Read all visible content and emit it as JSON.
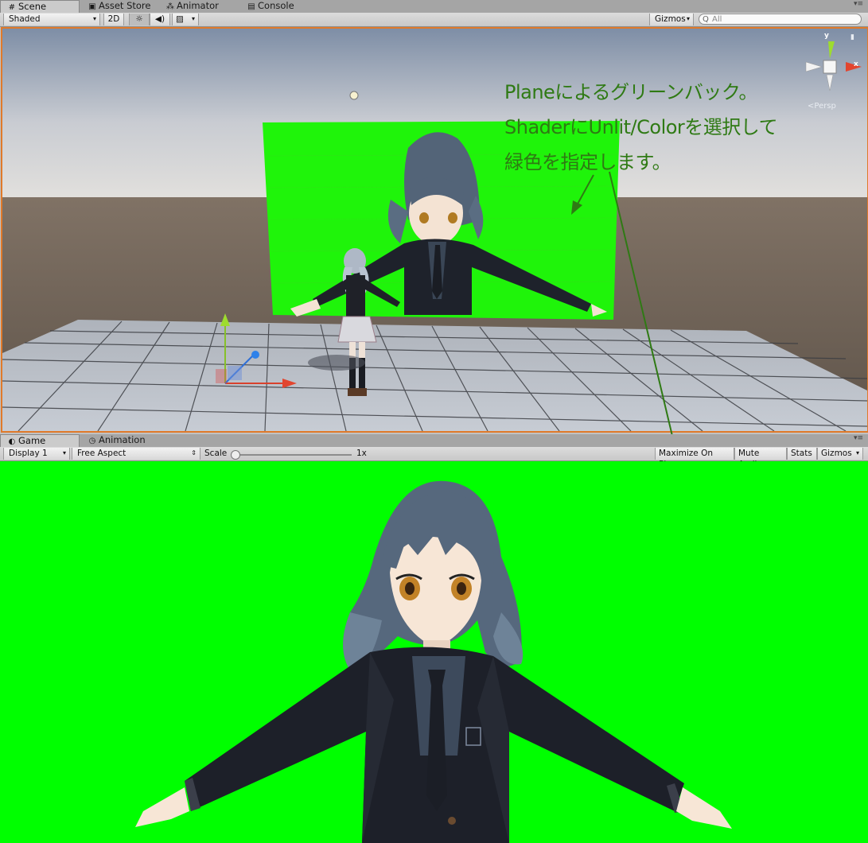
{
  "scene_tabs": [
    {
      "label": "Scene",
      "icon": "hash-icon",
      "active": true
    },
    {
      "label": "Asset Store",
      "icon": "shopping-bag-icon",
      "active": false
    },
    {
      "label": "Animator",
      "icon": "animator-icon",
      "active": false
    },
    {
      "label": "Console",
      "icon": "console-icon",
      "active": false
    }
  ],
  "scene_toolbar": {
    "draw_mode": "Shaded",
    "mode_2d": "2D",
    "lighting_icon": "sun-icon",
    "audio_icon": "speaker-icon",
    "effects_icon": "image-icon",
    "gizmos_label": "Gizmos",
    "search_placeholder": "All"
  },
  "scene_view": {
    "gizmo_labels": {
      "x": "x",
      "y": "y"
    },
    "projection_label": "Persp"
  },
  "annotation": {
    "lines": [
      "Planeによるグリーンバック。",
      "ShaderにUnlit/Colorを選択して",
      "緑色を指定します。"
    ],
    "color": "#2f7a14"
  },
  "game_tabs": [
    {
      "label": "Game",
      "icon": "pacman-icon",
      "active": true
    },
    {
      "label": "Animation",
      "icon": "clock-icon",
      "active": false
    }
  ],
  "game_toolbar": {
    "display": "Display 1",
    "aspect": "Free Aspect",
    "scale_label": "Scale",
    "scale_value": "1x",
    "scale_level": 0.0,
    "maximize_on_play": "Maximize On Play",
    "mute_audio": "Mute Audio",
    "stats": "Stats",
    "gizmos": "Gizmos"
  },
  "colors": {
    "green_screen": "#00ff00",
    "selection_border": "#e07a2a",
    "sky_top": "#8a9ab0",
    "ground": "#6b5e52"
  }
}
